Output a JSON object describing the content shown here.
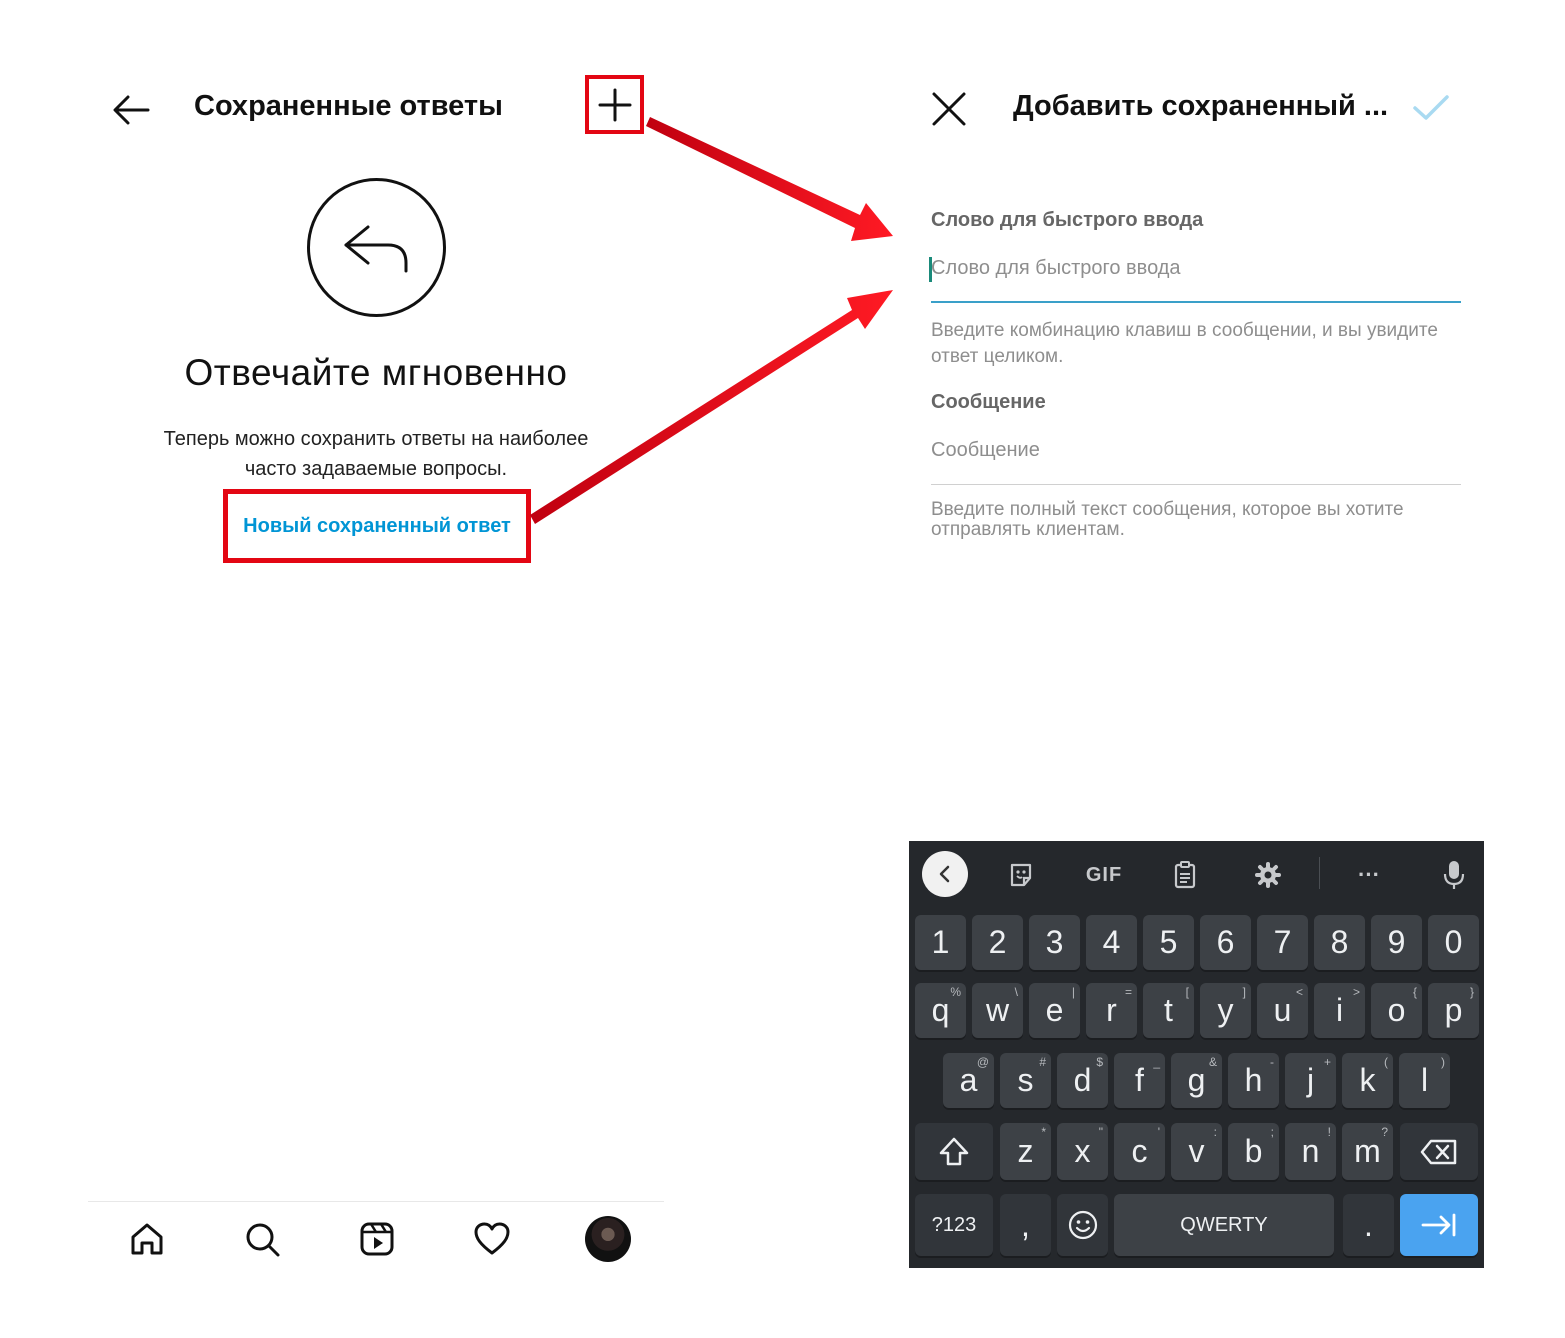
{
  "left_screen": {
    "title": "Сохраненные ответы",
    "heading": "Отвечайте мгновенно",
    "description": "Теперь можно сохранить ответы на наиболее часто задаваемые вопросы.",
    "new_reply_link": "Новый сохраненный ответ",
    "icons": [
      "back-arrow-icon",
      "plus-icon",
      "reply-icon"
    ],
    "bottom_nav": [
      "home-icon",
      "search-icon",
      "reels-icon",
      "heart-icon",
      "profile-avatar"
    ]
  },
  "right_screen": {
    "title": "Добавить сохраненный ...",
    "shortcut": {
      "label": "Слово для быстрого ввода",
      "placeholder": "Слово для быстрого ввода",
      "hint": "Введите комбинацию клавиш в сообщении, и вы увидите ответ целиком."
    },
    "message": {
      "label": "Сообщение",
      "placeholder": "Сообщение",
      "hint": "Введите полный текст сообщения, которое вы хотите отправлять клиентам."
    }
  },
  "keyboard": {
    "toolbar": {
      "gif": "GIF",
      "more": "···"
    },
    "row_numbers": [
      "1",
      "2",
      "3",
      "4",
      "5",
      "6",
      "7",
      "8",
      "9",
      "0"
    ],
    "row1": [
      {
        "k": "q",
        "s": "%"
      },
      {
        "k": "w",
        "s": "\\"
      },
      {
        "k": "e",
        "s": "|"
      },
      {
        "k": "r",
        "s": "="
      },
      {
        "k": "t",
        "s": "["
      },
      {
        "k": "y",
        "s": "]"
      },
      {
        "k": "u",
        "s": "<"
      },
      {
        "k": "i",
        "s": ">"
      },
      {
        "k": "o",
        "s": "{"
      },
      {
        "k": "p",
        "s": "}"
      }
    ],
    "row2": [
      {
        "k": "a",
        "s": "@"
      },
      {
        "k": "s",
        "s": "#"
      },
      {
        "k": "d",
        "s": "$"
      },
      {
        "k": "f",
        "s": "_"
      },
      {
        "k": "g",
        "s": "&"
      },
      {
        "k": "h",
        "s": "-"
      },
      {
        "k": "j",
        "s": "+"
      },
      {
        "k": "k",
        "s": "("
      },
      {
        "k": "l",
        "s": ")"
      }
    ],
    "row3": [
      {
        "k": "z",
        "s": "*"
      },
      {
        "k": "x",
        "s": "\""
      },
      {
        "k": "c",
        "s": "'"
      },
      {
        "k": "v",
        "s": ":"
      },
      {
        "k": "b",
        "s": ";"
      },
      {
        "k": "n",
        "s": "!"
      },
      {
        "k": "m",
        "s": "?"
      }
    ],
    "symbols_key": "?123",
    "comma_key": ",",
    "space_key": "QWERTY",
    "period_key": ".",
    "colors": {
      "background": "#25282c",
      "key": "#3d4146",
      "enter": "#4aa3f0"
    }
  },
  "annotation_color": "#e30613",
  "link_color": "#0095d5"
}
